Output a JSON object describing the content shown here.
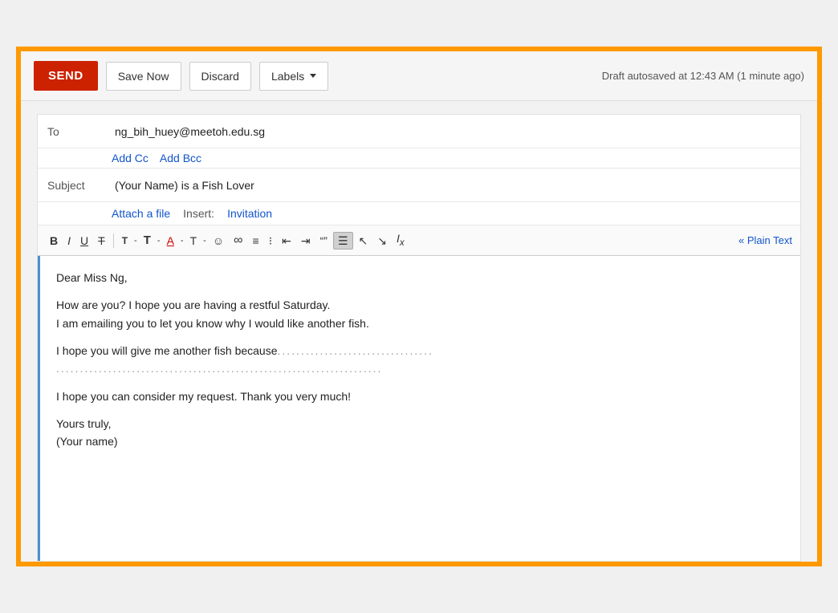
{
  "toolbar": {
    "send_label": "SEND",
    "save_label": "Save Now",
    "discard_label": "Discard",
    "labels_label": "Labels",
    "draft_status": "Draft autosaved at 12:43 AM (1 minute ago)"
  },
  "compose": {
    "to_label": "To",
    "to_value": "ng_bih_huey@meetoh.edu.sg",
    "add_cc": "Add Cc",
    "add_bcc": "Add Bcc",
    "subject_label": "Subject",
    "subject_value": "(Your Name) is a Fish Lover",
    "attach_file": "Attach a file",
    "insert_label": "Insert:",
    "insert_invitation": "Invitation",
    "plain_text": "« Plain Text"
  },
  "format": {
    "bold": "B",
    "italic": "I",
    "underline": "U",
    "strikethrough": "T",
    "size_increase": "T↑",
    "font_color": "A",
    "background_color": "T",
    "emoji": "☺",
    "link": "∞",
    "ordered_list": "≡",
    "unordered_list": "☰",
    "indent_left": "⇤",
    "indent_right": "⇥",
    "quote": "❝",
    "align_center": "≡",
    "align_left": "≡",
    "align_right": "≡",
    "clear_format": "Ix"
  },
  "body": {
    "line1": "Dear Miss Ng,",
    "line2": "How are you? I hope you are having a restful Saturday.",
    "line3": "I am emailing you to let you know why I would like another fish.",
    "line4": "I hope you will give me another fish because",
    "line5": "I hope you can consider my request. Thank you very much!",
    "line6": "Yours truly,",
    "line7": "(Your name)"
  }
}
